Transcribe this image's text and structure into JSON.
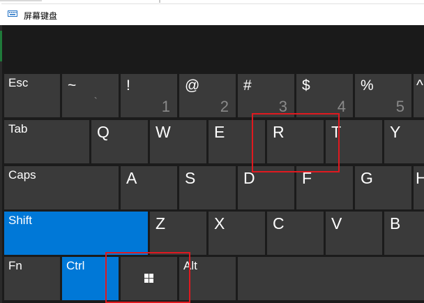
{
  "window": {
    "title": "屏幕键盘",
    "app_icon": "keyboard-icon"
  },
  "colors": {
    "key": "#3a3a3a",
    "accent": "#0078d7",
    "background": "#1b1b1b",
    "highlight": "#e0191f"
  },
  "keys": {
    "esc": "Esc",
    "tilde": {
      "top": "~",
      "bottom": "`"
    },
    "k1": {
      "top": "!",
      "bottom": "1"
    },
    "k2": {
      "top": "@",
      "bottom": "2"
    },
    "k3": {
      "top": "#",
      "bottom": "3"
    },
    "k4": {
      "top": "$",
      "bottom": "4"
    },
    "k5": {
      "top": "%",
      "bottom": "5"
    },
    "k6": {
      "top": "^"
    },
    "tab": "Tab",
    "q": "Q",
    "w": "W",
    "e": "E",
    "r": "R",
    "t": "T",
    "y": "Y",
    "caps": "Caps",
    "a": "A",
    "s": "S",
    "d": "D",
    "f": "F",
    "g": "G",
    "h": "H",
    "shift": "Shift",
    "z": "Z",
    "x": "X",
    "c": "C",
    "v": "V",
    "b": "B",
    "fn": "Fn",
    "ctrl": "Ctrl",
    "win": "windows-logo-icon",
    "alt": "Alt"
  },
  "annotations": [
    "highlight-r-key",
    "highlight-windows-key"
  ]
}
